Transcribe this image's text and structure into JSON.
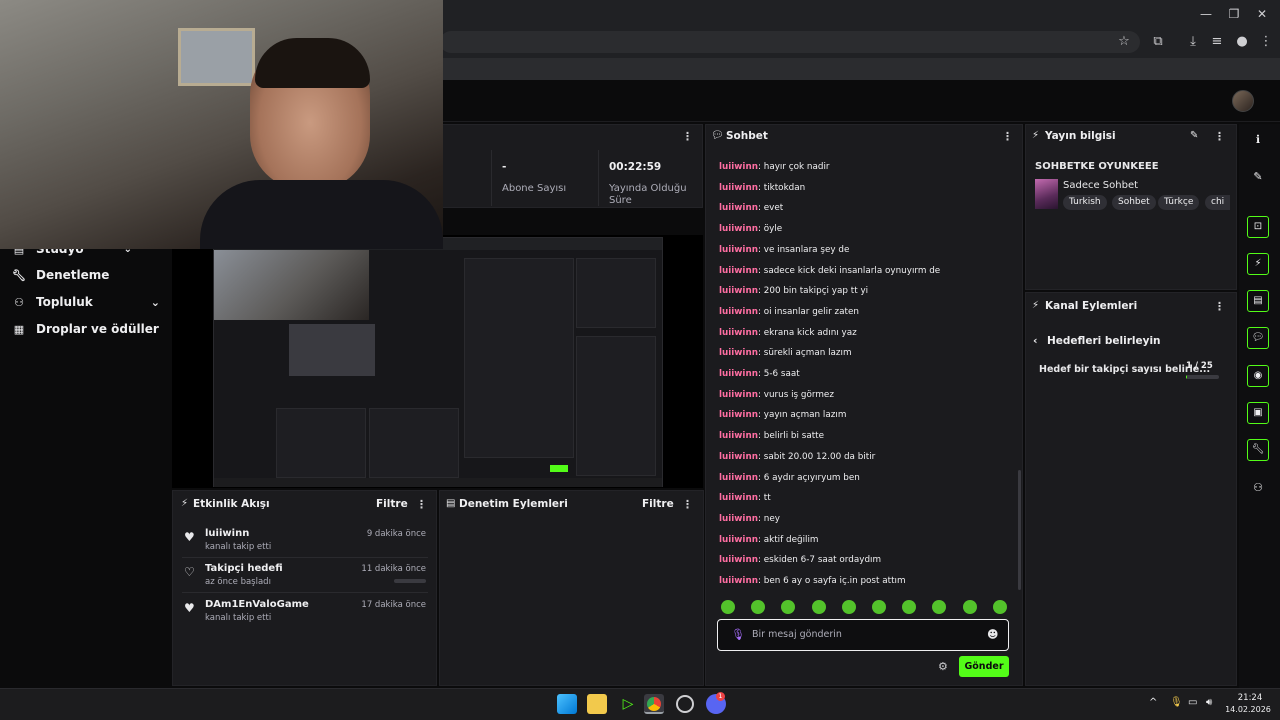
{
  "nav": {
    "studio": "Stüdyo",
    "moderation": "Denetleme",
    "community": "Topluluk",
    "drops": "Droplar ve ödüller"
  },
  "stats": {
    "subscribers_value": "-",
    "subscribers_label": "Abone Sayısı",
    "uptime_value": "00:22:59",
    "uptime_label": "Yayında Olduğu Süre"
  },
  "chat": {
    "title": "Sohbet",
    "messages": [
      {
        "user": "luiiwinn",
        "text": "hayır çok nadir"
      },
      {
        "user": "luiiwinn",
        "text": "tiktokdan"
      },
      {
        "user": "luiiwinn",
        "text": "evet"
      },
      {
        "user": "luiiwinn",
        "text": "öyle"
      },
      {
        "user": "luiiwinn",
        "text": "ve insanlara şey de"
      },
      {
        "user": "luiiwinn",
        "text": "sadece kick deki insanlarla oynuyırm de"
      },
      {
        "user": "luiiwinn",
        "text": "200 bin takipçi yap tt yi"
      },
      {
        "user": "luiiwinn",
        "text": "oi insanlar gelir zaten"
      },
      {
        "user": "luiiwinn",
        "text": "ekrana kick adını yaz"
      },
      {
        "user": "luiiwinn",
        "text": "sürekli açman lazım"
      },
      {
        "user": "luiiwinn",
        "text": "5-6 saat"
      },
      {
        "user": "luiiwinn",
        "text": "vurus iş görmez"
      },
      {
        "user": "luiiwinn",
        "text": "yayın açman lazım"
      },
      {
        "user": "luiiwinn",
        "text": "belirli bi satte"
      },
      {
        "user": "luiiwinn",
        "text": "sabit 20.00 12.00 da bitir"
      },
      {
        "user": "luiiwinn",
        "text": "6 aydır açıyıryum ben"
      },
      {
        "user": "luiiwinn",
        "text": "tt"
      },
      {
        "user": "luiiwinn",
        "text": "ney"
      },
      {
        "user": "luiiwinn",
        "text": "aktif değilim"
      },
      {
        "user": "luiiwinn",
        "text": "eskiden 6-7 saat ordaydım"
      },
      {
        "user": "luiiwinn",
        "text": "ben 6 ay o sayfa iç.in post attım"
      }
    ],
    "input_placeholder": "Bir mesaj gönderin",
    "send_label": "Gönder",
    "colon": ": "
  },
  "stream_info": {
    "title": "Yayın bilgisi",
    "stream_title": "SOHBETKE OYUNKEEE",
    "category": "Sadece Sohbet",
    "tags": [
      "Turkish",
      "Sohbet",
      "Türkçe",
      "chi"
    ]
  },
  "channel_actions": {
    "title": "Kanal Eylemleri",
    "back_label": "Hedefleri belirleyin",
    "goal_label": "Hedef bir takipçi sayısı belirle...",
    "goal_progress": "1 / 25",
    "goal_fraction": 0.04
  },
  "activity": {
    "title": "Etkinlik Akışı",
    "filter": "Filtre",
    "items": [
      {
        "name": "luiiwinn",
        "sub": "kanalı takip etti",
        "time": "9 dakika önce",
        "icon": "heart-filled-icon"
      },
      {
        "name": "Takipçi hedefi",
        "sub": "az önce başladı",
        "time": "11 dakika önce",
        "icon": "heart-outline-icon"
      },
      {
        "name": "DAm1EnValoGame",
        "sub": "kanalı takip etti",
        "time": "17 dakika önce",
        "icon": "heart-filled-icon"
      }
    ]
  },
  "moderation_actions": {
    "title": "Denetim Eylemleri",
    "filter": "Filtre"
  },
  "taskbar": {
    "time": "21:24",
    "date": "14.02.2026",
    "discord_badge": "1"
  },
  "colors": {
    "accent": "#53fc18",
    "username": "#ff6ea2",
    "panel": "#1b1b1e",
    "background": "#0b0b0c"
  }
}
